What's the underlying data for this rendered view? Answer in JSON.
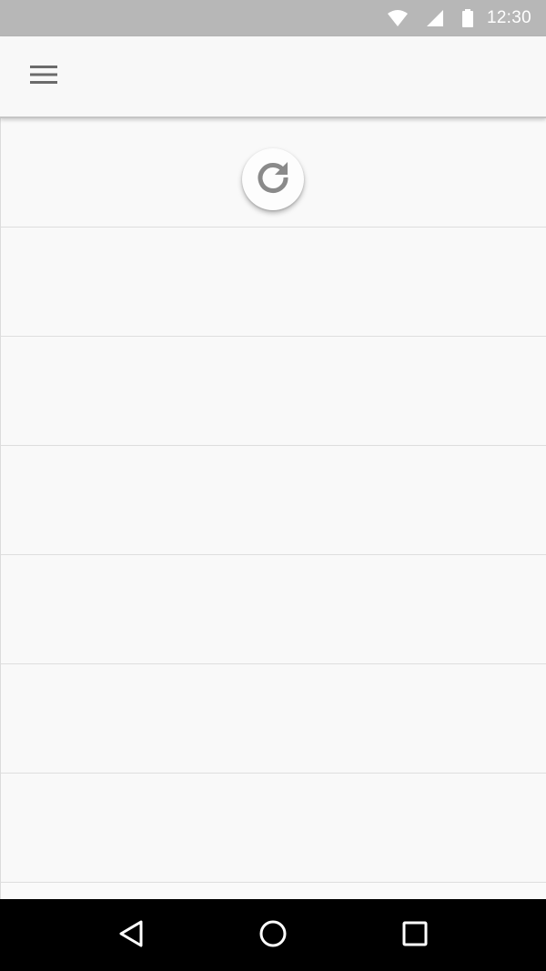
{
  "status_bar": {
    "time": "12:30",
    "icons": [
      "wifi-icon",
      "cell-signal-icon",
      "battery-icon"
    ],
    "background": "#b7b7b7"
  },
  "app_bar": {
    "menu_icon": "menu-icon",
    "background": "#f8f8f8"
  },
  "refresh": {
    "icon": "refresh-icon",
    "state": "pulling"
  },
  "list": {
    "items": [
      {
        "id": 1
      },
      {
        "id": 2
      },
      {
        "id": 3
      },
      {
        "id": 4
      },
      {
        "id": 5
      },
      {
        "id": 6
      },
      {
        "id": 7
      }
    ]
  },
  "nav_bar": {
    "buttons": [
      "back-icon",
      "home-icon",
      "recents-icon"
    ],
    "background": "#000000"
  }
}
